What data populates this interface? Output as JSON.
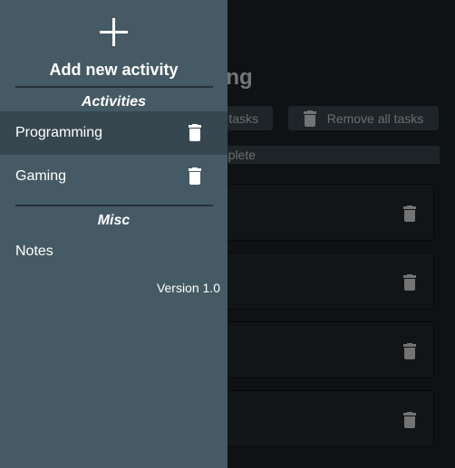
{
  "background": {
    "page_title": "mming",
    "tasks_button_label": "tasks",
    "remove_all_label": "Remove all tasks",
    "subheader_label": "mplete",
    "task_count": 4
  },
  "drawer": {
    "add_label": "Add new activity",
    "activities_heading": "Activities",
    "activities": [
      {
        "label": "Programming",
        "active": true
      },
      {
        "label": "Gaming",
        "active": false
      }
    ],
    "misc_heading": "Misc",
    "misc_items": [
      {
        "label": "Notes"
      }
    ],
    "version": "Version 1.0"
  },
  "colors": {
    "drawer_bg": "#455a64",
    "active_item_bg": "#37474f",
    "app_bg": "#1e2428"
  },
  "icons": [
    "add-icon",
    "trash-icon"
  ]
}
